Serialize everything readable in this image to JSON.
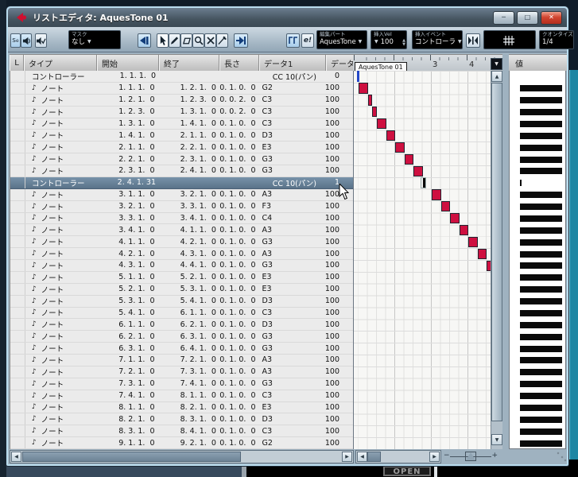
{
  "window": {
    "title": "リストエディタ: AquesTone 01",
    "minimize": "─",
    "maximize": "□",
    "close": "✕"
  },
  "toolbar": {
    "solo_label": "s",
    "solo_sup": "e",
    "mask_label": "マスク",
    "mask_value": "なし",
    "e_button": "e!",
    "edit_part_label": "編集パート",
    "edit_part_value": "AquesTone",
    "insert_vel_label": "挿入Vel",
    "insert_vel_value": "100",
    "insert_event_label": "挿入イベント",
    "insert_event_value": "コントローラ",
    "quantize_label": "クオンタイズ",
    "quantize_value": "1/4",
    "dd_arrow": "▼",
    "spin_up": "▲",
    "spin_down": "▼"
  },
  "table": {
    "columns": [
      "L",
      "タイプ",
      "開始",
      "終了",
      "長さ",
      "データ1",
      "データ"
    ],
    "note_icon": "♪",
    "rows": [
      {
        "t": "コントローラー",
        "s": "1. 1. 1.  0",
        "e": "",
        "l": "",
        "d1": "CC 10(パン)",
        "d2": "0",
        "ctrl": true
      },
      {
        "t": "ノート",
        "s": "1. 1. 1.  0",
        "e": "1. 2. 1.  0",
        "l": "0. 1. 0.  0",
        "d1": "G2",
        "d2": "100"
      },
      {
        "t": "ノート",
        "s": "1. 2. 1.  0",
        "e": "1. 2. 3.  0",
        "l": "0. 0. 2.  0",
        "d1": "C3",
        "d2": "100"
      },
      {
        "t": "ノート",
        "s": "1. 2. 3.  0",
        "e": "1. 3. 1.  0",
        "l": "0. 0. 2.  0",
        "d1": "C3",
        "d2": "100"
      },
      {
        "t": "ノート",
        "s": "1. 3. 1.  0",
        "e": "1. 4. 1.  0",
        "l": "0. 1. 0.  0",
        "d1": "C3",
        "d2": "100"
      },
      {
        "t": "ノート",
        "s": "1. 4. 1.  0",
        "e": "2. 1. 1.  0",
        "l": "0. 1. 0.  0",
        "d1": "D3",
        "d2": "100"
      },
      {
        "t": "ノート",
        "s": "2. 1. 1.  0",
        "e": "2. 2. 1.  0",
        "l": "0. 1. 0.  0",
        "d1": "E3",
        "d2": "100"
      },
      {
        "t": "ノート",
        "s": "2. 2. 1.  0",
        "e": "2. 3. 1.  0",
        "l": "0. 1. 0.  0",
        "d1": "G3",
        "d2": "100"
      },
      {
        "t": "ノート",
        "s": "2. 3. 1.  0",
        "e": "2. 4. 1.  0",
        "l": "0. 1. 0.  0",
        "d1": "G3",
        "d2": "100"
      },
      {
        "t": "コントローラー",
        "s": "2. 4. 1. 31",
        "e": "",
        "l": "",
        "d1": "CC 10(パン)",
        "d2": "1",
        "ctrl": true,
        "sel": true
      },
      {
        "t": "ノート",
        "s": "3. 1. 1.  0",
        "e": "3. 2. 1.  0",
        "l": "0. 1. 0.  0",
        "d1": "A3",
        "d2": "100"
      },
      {
        "t": "ノート",
        "s": "3. 2. 1.  0",
        "e": "3. 3. 1.  0",
        "l": "0. 1. 0.  0",
        "d1": "F3",
        "d2": "100"
      },
      {
        "t": "ノート",
        "s": "3. 3. 1.  0",
        "e": "3. 4. 1.  0",
        "l": "0. 1. 0.  0",
        "d1": "C4",
        "d2": "100"
      },
      {
        "t": "ノート",
        "s": "3. 4. 1.  0",
        "e": "4. 1. 1.  0",
        "l": "0. 1. 0.  0",
        "d1": "A3",
        "d2": "100"
      },
      {
        "t": "ノート",
        "s": "4. 1. 1.  0",
        "e": "4. 2. 1.  0",
        "l": "0. 1. 0.  0",
        "d1": "G3",
        "d2": "100"
      },
      {
        "t": "ノート",
        "s": "4. 2. 1.  0",
        "e": "4. 3. 1.  0",
        "l": "0. 1. 0.  0",
        "d1": "A3",
        "d2": "100"
      },
      {
        "t": "ノート",
        "s": "4. 3. 1.  0",
        "e": "4. 4. 1.  0",
        "l": "0. 1. 0.  0",
        "d1": "G3",
        "d2": "100"
      },
      {
        "t": "ノート",
        "s": "5. 1. 1.  0",
        "e": "5. 2. 1.  0",
        "l": "0. 1. 0.  0",
        "d1": "E3",
        "d2": "100"
      },
      {
        "t": "ノート",
        "s": "5. 2. 1.  0",
        "e": "5. 3. 1.  0",
        "l": "0. 1. 0.  0",
        "d1": "E3",
        "d2": "100"
      },
      {
        "t": "ノート",
        "s": "5. 3. 1.  0",
        "e": "5. 4. 1.  0",
        "l": "0. 1. 0.  0",
        "d1": "D3",
        "d2": "100"
      },
      {
        "t": "ノート",
        "s": "5. 4. 1.  0",
        "e": "6. 1. 1.  0",
        "l": "0. 1. 0.  0",
        "d1": "C3",
        "d2": "100"
      },
      {
        "t": "ノート",
        "s": "6. 1. 1.  0",
        "e": "6. 2. 1.  0",
        "l": "0. 1. 0.  0",
        "d1": "D3",
        "d2": "100"
      },
      {
        "t": "ノート",
        "s": "6. 2. 1.  0",
        "e": "6. 3. 1.  0",
        "l": "0. 1. 0.  0",
        "d1": "G3",
        "d2": "100"
      },
      {
        "t": "ノート",
        "s": "6. 3. 1.  0",
        "e": "6. 4. 1.  0",
        "l": "0. 1. 0.  0",
        "d1": "G3",
        "d2": "100"
      },
      {
        "t": "ノート",
        "s": "7. 1. 1.  0",
        "e": "7. 2. 1.  0",
        "l": "0. 1. 0.  0",
        "d1": "A3",
        "d2": "100"
      },
      {
        "t": "ノート",
        "s": "7. 2. 1.  0",
        "e": "7. 3. 1.  0",
        "l": "0. 1. 0.  0",
        "d1": "A3",
        "d2": "100"
      },
      {
        "t": "ノート",
        "s": "7. 3. 1.  0",
        "e": "7. 4. 1.  0",
        "l": "0. 1. 0.  0",
        "d1": "G3",
        "d2": "100"
      },
      {
        "t": "ノート",
        "s": "7. 4. 1.  0",
        "e": "8. 1. 1.  0",
        "l": "0. 1. 0.  0",
        "d1": "C3",
        "d2": "100"
      },
      {
        "t": "ノート",
        "s": "8. 1. 1.  0",
        "e": "8. 2. 1.  0",
        "l": "0. 1. 0.  0",
        "d1": "E3",
        "d2": "100"
      },
      {
        "t": "ノート",
        "s": "8. 2. 1.  0",
        "e": "8. 3. 1.  0",
        "l": "0. 1. 0.  0",
        "d1": "D3",
        "d2": "100"
      },
      {
        "t": "ノート",
        "s": "8. 3. 1.  0",
        "e": "8. 4. 1.  0",
        "l": "0. 1. 0.  0",
        "d1": "C3",
        "d2": "100"
      },
      {
        "t": "ノート",
        "s": "9. 1. 1.  0",
        "e": "9. 2. 1.  0",
        "l": "0. 1. 0.  0",
        "d1": "G2",
        "d2": "100"
      }
    ]
  },
  "ruler": {
    "part_label": "AquesTone 01",
    "bar_numbers": [
      3,
      4
    ]
  },
  "value_panel": {
    "header": "値"
  },
  "desktop": {
    "open_label": "OPEN"
  },
  "colors": {
    "note": "#ce1040",
    "selected_row": "#64809b",
    "teal_edge": "#1e86a3",
    "close_button": "#c23422"
  }
}
